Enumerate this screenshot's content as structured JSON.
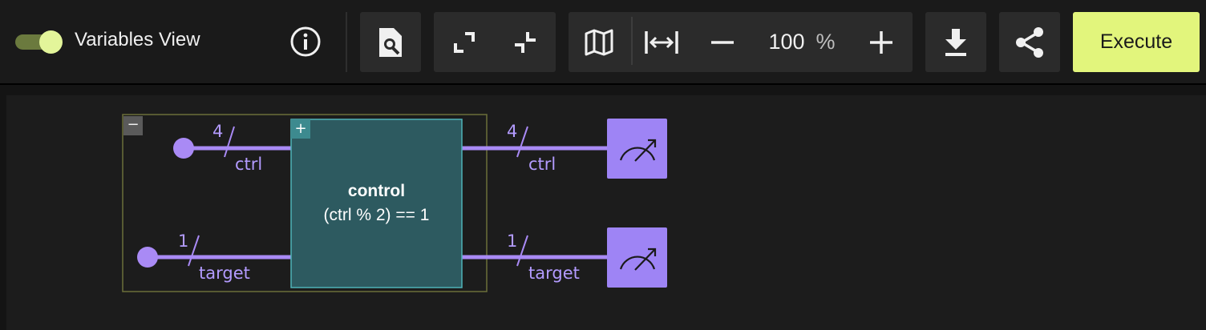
{
  "toolbar": {
    "variables_view_label": "Variables View",
    "variables_view_on": true,
    "zoom_value": "100",
    "zoom_unit": "%",
    "execute_label": "Execute"
  },
  "circuit": {
    "qubits": [
      {
        "name": "ctrl",
        "size": "4"
      },
      {
        "name": "target",
        "size": "1"
      }
    ],
    "gate": {
      "title": "control",
      "condition": "(ctrl % 2) == 1"
    },
    "outputs": [
      {
        "name": "ctrl",
        "size": "4"
      },
      {
        "name": "target",
        "size": "1"
      }
    ],
    "group_collapse_glyph": "−",
    "gate_expand_glyph": "+"
  },
  "colors": {
    "accent": "#e2f57c",
    "wire": "#a98af5",
    "gate_fill": "#2d5a60",
    "gate_border": "#4fb3b8",
    "group_border": "#6b6e3a",
    "measure_fill": "#9e84f5"
  }
}
